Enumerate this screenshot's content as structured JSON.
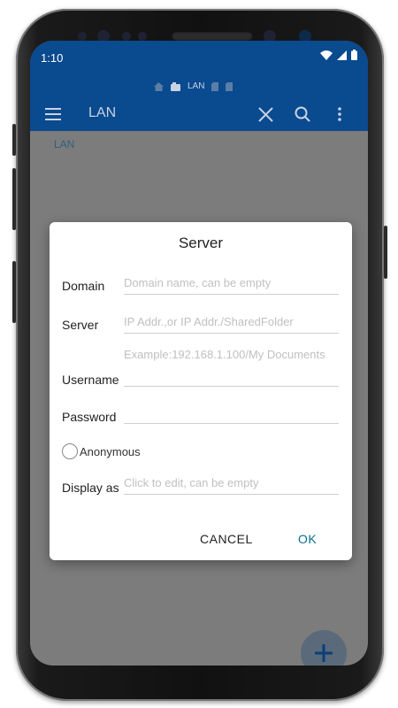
{
  "status": {
    "time": "1:10"
  },
  "breadcrumbs": {
    "home_icon": "home-icon",
    "current": "LAN"
  },
  "appbar": {
    "title": "LAN"
  },
  "content": {
    "label": "LAN"
  },
  "dialog": {
    "title": "Server",
    "domain": {
      "label": "Domain",
      "placeholder": "Domain name, can be empty"
    },
    "server": {
      "label": "Server",
      "placeholder": "IP Addr.,or IP Addr./SharedFolder",
      "hint": "Example:192.168.1.100/My Documents"
    },
    "username": {
      "label": "Username",
      "value": ""
    },
    "password": {
      "label": "Password",
      "value": ""
    },
    "anonymous": {
      "label": "Anonymous",
      "checked": false
    },
    "display_as": {
      "label": "Display as",
      "placeholder": "Click to edit, can be empty"
    },
    "cancel_label": "CANCEL",
    "ok_label": "OK"
  },
  "colors": {
    "primary": "#0a4a8f",
    "accent": "#0a6e8a",
    "scrim": "#7c7c7c"
  }
}
